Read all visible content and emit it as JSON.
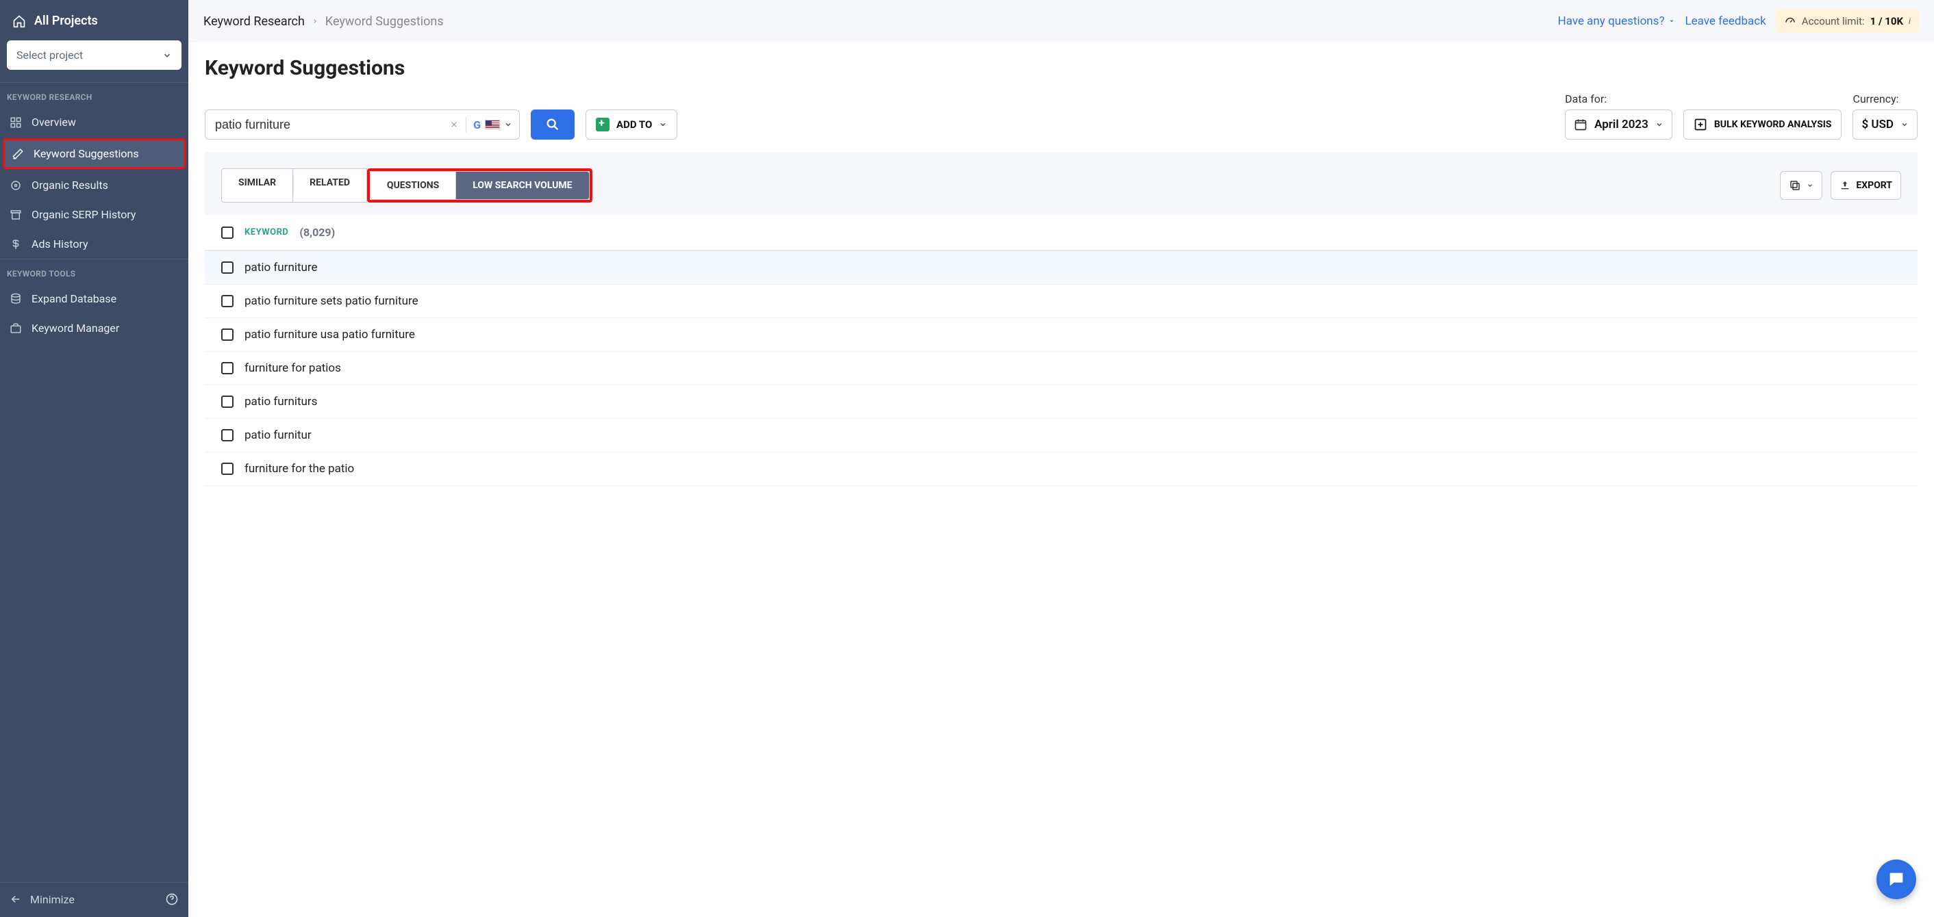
{
  "sidebar": {
    "allProjects": "All Projects",
    "selectProjectPlaceholder": "Select project",
    "sections": {
      "research": {
        "label": "KEYWORD RESEARCH",
        "items": [
          "Overview",
          "Keyword Suggestions",
          "Organic Results",
          "Organic SERP History",
          "Ads History"
        ],
        "activeIndex": 1
      },
      "tools": {
        "label": "KEYWORD TOOLS",
        "items": [
          "Expand Database",
          "Keyword Manager"
        ]
      }
    },
    "minimize": "Minimize"
  },
  "topbar": {
    "breadcrumbRoot": "Keyword Research",
    "breadcrumbCurrent": "Keyword Suggestions",
    "questionsLink": "Have any questions?",
    "feedbackLink": "Leave feedback",
    "accountLimit": {
      "label": "Account limit:",
      "value": "1 / 10K"
    }
  },
  "page": {
    "title": "Keyword Suggestions",
    "searchValue": "patio furniture",
    "addTo": "ADD TO",
    "dataForLabel": "Data for:",
    "dataForValue": "April 2023",
    "bulk": "BULK KEYWORD ANALYSIS",
    "currencyLabel": "Currency:",
    "currencyValue": "$ USD"
  },
  "tabs": {
    "items": [
      "SIMILAR",
      "RELATED",
      "QUESTIONS",
      "LOW SEARCH VOLUME"
    ],
    "highlightStart": 2,
    "highlightEnd": 3,
    "activeDarkIndex": 3
  },
  "actions": {
    "export": "EXPORT"
  },
  "table": {
    "headerLabel": "KEYWORD",
    "count": "(8,029)",
    "rows": [
      "patio furniture",
      "patio furniture sets patio furniture",
      "patio furniture usa patio furniture",
      "furniture for patios",
      "patio furniturs",
      "patio furnitur",
      "furniture for the patio"
    ],
    "highlightRowIndex": 0
  }
}
